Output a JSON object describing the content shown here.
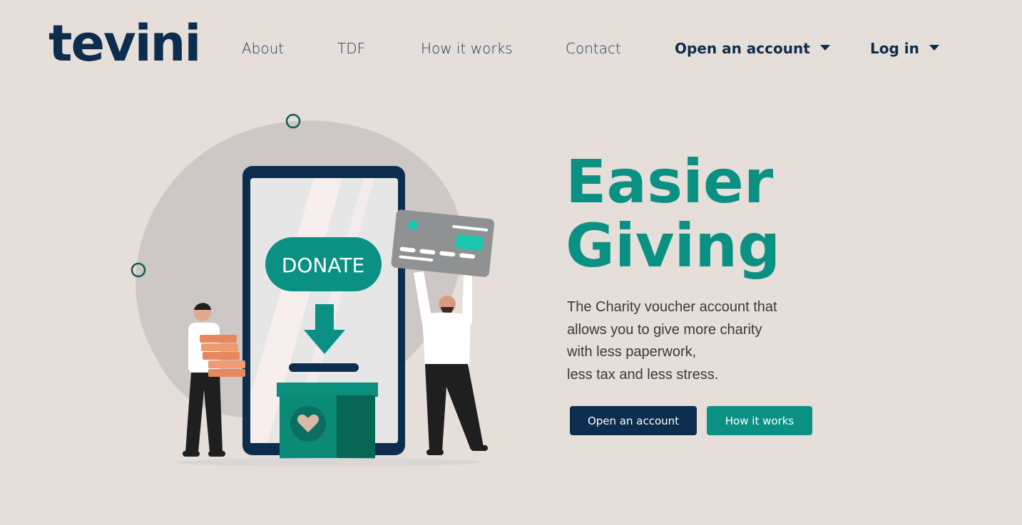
{
  "brand": {
    "name": "tevini"
  },
  "nav": {
    "about": "About",
    "tdf": "TDF",
    "how_it_works": "How it works",
    "contact": "Contact",
    "open_account": "Open an account",
    "login": "Log in"
  },
  "hero": {
    "title_line1": "Easier",
    "title_line2": "Giving",
    "description_lines": [
      "The Charity voucher account that",
      "allows you to give more charity",
      "with less paperwork,",
      "less tax and less stress."
    ],
    "illustration": {
      "donate_label": "DONATE"
    }
  },
  "buttons": {
    "open_account": "Open an account",
    "how_it_works": "How it works"
  },
  "colors": {
    "background": "#e5ded9",
    "navy": "#0c2d4d",
    "teal": "#0b9183"
  }
}
